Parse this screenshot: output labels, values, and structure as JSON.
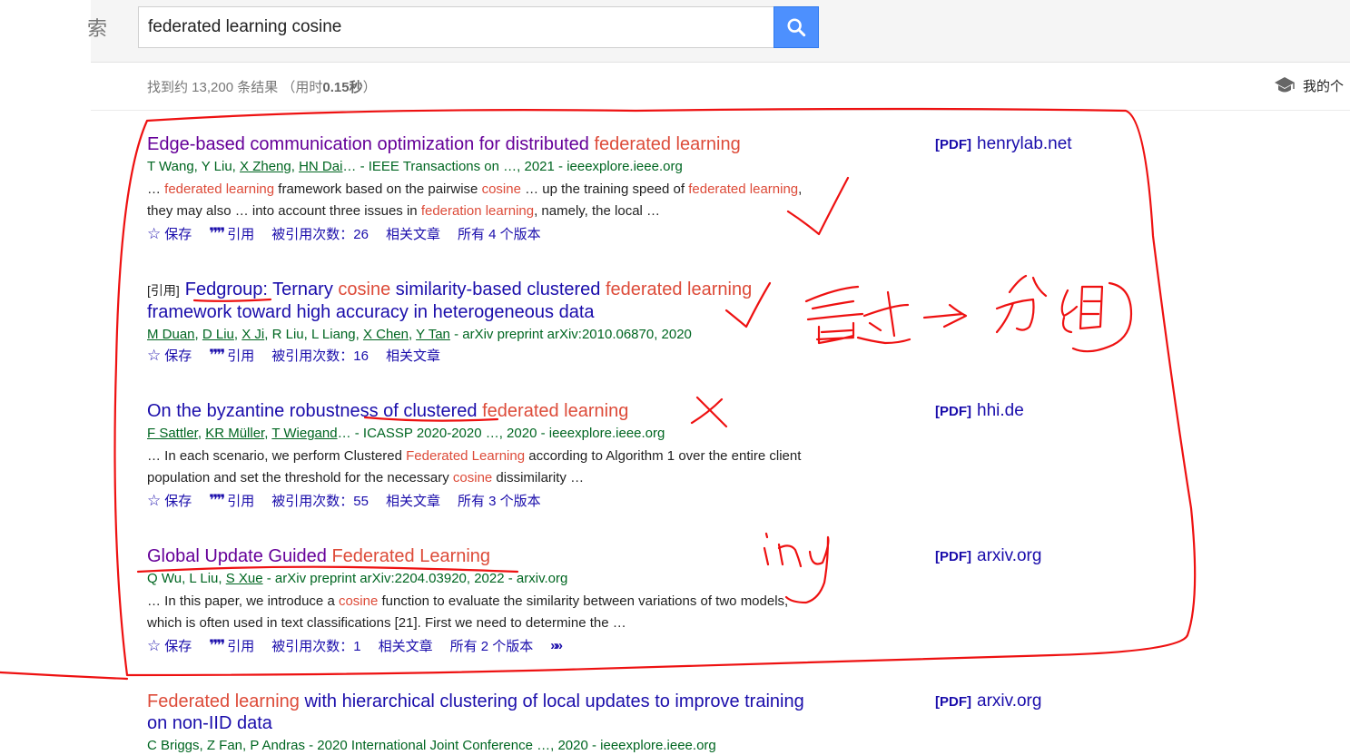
{
  "header": {
    "logo_fragment": "索",
    "search_value": "federated learning cosine",
    "stats_prefix": "找到约 13,200 条结果 （用时",
    "stats_time": "0.15秒",
    "stats_suffix": "）",
    "my_library_label": "我的个"
  },
  "results": [
    {
      "title_parts": [
        {
          "text": "Edge-based communication optimization for distributed ",
          "hl": false
        },
        {
          "text": "federated learning",
          "hl": true
        }
      ],
      "author_parts": [
        {
          "text": "T Wang, Y Liu, ",
          "u": false
        },
        {
          "text": "X Zheng",
          "u": true
        },
        {
          "text": ", ",
          "u": false
        },
        {
          "text": "HN Dai",
          "u": true
        },
        {
          "text": "… - IEEE Transactions on …, 2021 - ieeexplore.ieee.org",
          "u": false
        }
      ],
      "snippet_parts": [
        {
          "text": "… ",
          "hl": false
        },
        {
          "text": "federated learning",
          "hl": true
        },
        {
          "text": " framework based on the pairwise ",
          "hl": false
        },
        {
          "text": "cosine",
          "hl": true
        },
        {
          "text": " … up the training speed of ",
          "hl": false
        },
        {
          "text": "federated learning",
          "hl": true
        },
        {
          "text": ", they may also … into account three issues in ",
          "hl": false
        },
        {
          "text": "federation learning",
          "hl": true
        },
        {
          "text": ", namely, the local …",
          "hl": false
        }
      ],
      "actions": [
        "保存",
        "引用",
        "被引用次数：26",
        "相关文章",
        "所有 4 个版本"
      ],
      "pdf": {
        "tag": "[PDF]",
        "domain": "henrylab.net"
      }
    },
    {
      "prefix": "[引用]",
      "title_parts": [
        {
          "text": "Fedgroup: Ternary ",
          "hl": false
        },
        {
          "text": "cosine",
          "hl": true
        },
        {
          "text": " similarity-based clustered ",
          "hl": false
        },
        {
          "text": "federated learning",
          "hl": true
        },
        {
          "text": " framework toward high accuracy in heterogeneous data",
          "hl": false
        }
      ],
      "author_parts": [
        {
          "text": "M Duan",
          "u": true
        },
        {
          "text": ", ",
          "u": false
        },
        {
          "text": "D Liu",
          "u": true
        },
        {
          "text": ", ",
          "u": false
        },
        {
          "text": "X Ji",
          "u": true
        },
        {
          "text": ", R Liu, L Liang, ",
          "u": false
        },
        {
          "text": "X Chen",
          "u": true
        },
        {
          "text": ", ",
          "u": false
        },
        {
          "text": "Y Tan",
          "u": true
        },
        {
          "text": " - arXiv preprint arXiv:2010.06870, 2020",
          "u": false
        }
      ],
      "actions": [
        "保存",
        "引用",
        "被引用次数：16",
        "相关文章"
      ]
    },
    {
      "title_parts": [
        {
          "text": "On the byzantine robustness of clustered ",
          "hl": false
        },
        {
          "text": "federated learning",
          "hl": true
        }
      ],
      "author_parts": [
        {
          "text": "F Sattler",
          "u": true
        },
        {
          "text": ", ",
          "u": false
        },
        {
          "text": "KR Müller",
          "u": true
        },
        {
          "text": ", ",
          "u": false
        },
        {
          "text": "T Wiegand",
          "u": true
        },
        {
          "text": "… - ICASSP 2020-2020 …, 2020 - ieeexplore.ieee.org",
          "u": false
        }
      ],
      "snippet_parts": [
        {
          "text": "… In each scenario, we perform Clustered ",
          "hl": false
        },
        {
          "text": "Federated Learning",
          "hl": true
        },
        {
          "text": " according to Algorithm 1 over the entire client population and set the threshold for the necessary ",
          "hl": false
        },
        {
          "text": "cosine",
          "hl": true
        },
        {
          "text": " dissimilarity …",
          "hl": false
        }
      ],
      "actions": [
        "保存",
        "引用",
        "被引用次数：55",
        "相关文章",
        "所有 3 个版本"
      ],
      "pdf": {
        "tag": "[PDF]",
        "domain": "hhi.de"
      }
    },
    {
      "title_parts": [
        {
          "text": "Global Update Guided ",
          "hl": false
        },
        {
          "text": "Federated Learning",
          "hl": true
        }
      ],
      "author_parts": [
        {
          "text": "Q Wu, L Liu, ",
          "u": false
        },
        {
          "text": "S Xue",
          "u": true
        },
        {
          "text": " - arXiv preprint arXiv:2204.03920, 2022 - arxiv.org",
          "u": false
        }
      ],
      "snippet_parts": [
        {
          "text": "… In this paper, we introduce a ",
          "hl": false
        },
        {
          "text": "cosine",
          "hl": true
        },
        {
          "text": " function to evaluate the similarity between variations of two models, which is often used in text classifications [21]. First we need to determine the …",
          "hl": false
        }
      ],
      "actions": [
        "保存",
        "引用",
        "被引用次数：1",
        "相关文章",
        "所有 2 个版本"
      ],
      "pdf": {
        "tag": "[PDF]",
        "domain": "arxiv.org"
      }
    },
    {
      "title_parts": [
        {
          "text": "Federated learning",
          "hl": true
        },
        {
          "text": " with hierarchical clustering of local updates to improve training on non-IID data",
          "hl": false
        }
      ],
      "author_parts": [
        {
          "text": "C Briggs, Z Fan, P Andras - 2020 International Joint Conference …, 2020 - ieeexplore.ieee.org",
          "u": false
        }
      ],
      "pdf": {
        "tag": "[PDF]",
        "domain": "arxiv.org"
      }
    }
  ],
  "annotations": {
    "handwriting_1": "看过 → 分组",
    "handwriting_2": "ing",
    "ink_color": "#ee1111"
  }
}
